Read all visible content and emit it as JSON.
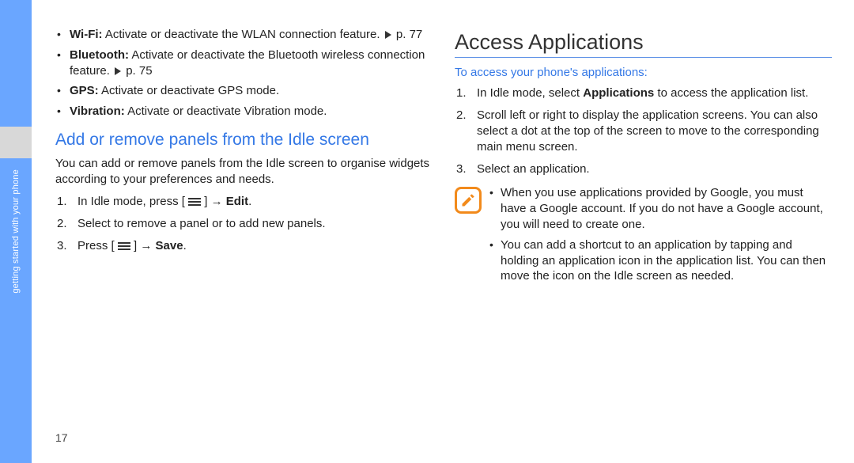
{
  "tab_label": "getting started with your phone",
  "page_number": "17",
  "left": {
    "bullets": [
      {
        "bold": "Wi-Fi:",
        "rest": " Activate or deactivate the WLAN connection feature. ",
        "ref": " p. 77",
        "arrow": true
      },
      {
        "bold": "Bluetooth:",
        "rest": " Activate or deactivate the Bluetooth wireless connection feature. ",
        "ref": " p. 75",
        "arrow": true
      },
      {
        "bold": "GPS:",
        "rest": " Activate or deactivate GPS mode."
      },
      {
        "bold": "Vibration:",
        "rest": " Activate or deactivate Vibration mode."
      }
    ],
    "heading": "Add or remove panels from the Idle screen",
    "para": "You can add or remove panels from the Idle screen to organise widgets according to your preferences and needs.",
    "steps": {
      "s1_pre": "In Idle mode, press [ ",
      "s1_post": " ] → ",
      "s1_bold": "Edit",
      "s1_tail": ".",
      "s2_a": "Select ",
      "s2_gap1": "     ",
      "s2_b": " to remove a panel or ",
      "s2_gap2": "     ",
      "s2_c": " to add new panels.",
      "s3_pre": "Press [ ",
      "s3_post": " ] → ",
      "s3_bold": "Save",
      "s3_tail": "."
    }
  },
  "right": {
    "title": "Access Applications",
    "sub": "To access your phone's applications:",
    "steps": [
      {
        "pre": "In Idle mode, select ",
        "bold": "Applications",
        "post": " to access the application list."
      },
      {
        "text": "Scroll left or right to display the application screens. You can also select a dot at the top of the screen to move to the corresponding main menu screen."
      },
      {
        "text": "Select an application."
      }
    ],
    "note": [
      "When you use applications provided by Google, you must have a Google account. If you do not have a Google account, you will need to create one.",
      "You can add a shortcut to an application by tapping and holding an application icon in the application list. You can then move the icon on the Idle screen as needed."
    ]
  }
}
